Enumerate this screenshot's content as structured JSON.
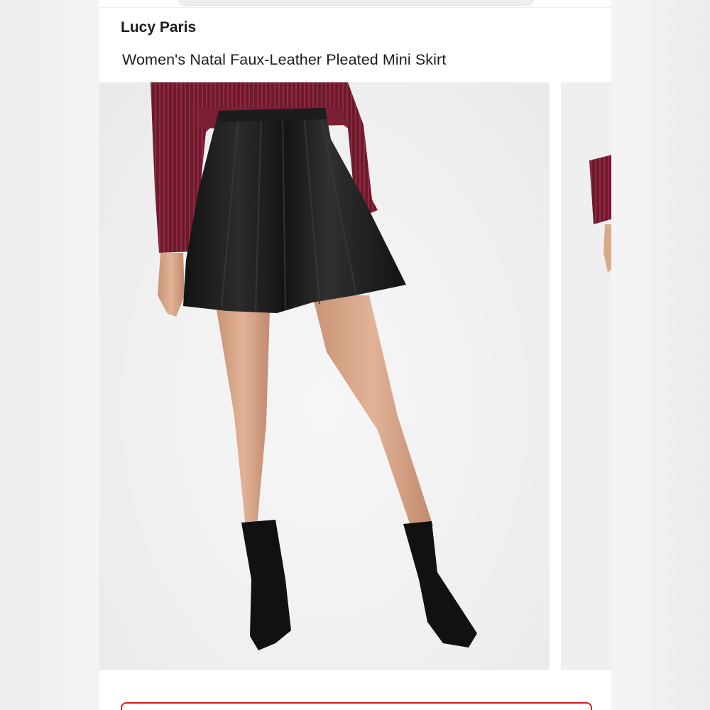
{
  "product": {
    "brand": "Lucy Paris",
    "title": "Women's Natal Faux-Leather Pleated Mini Skirt"
  },
  "gallery": {
    "main_image": "model wearing black faux-leather pleated mini skirt, burgundy pleated blouse and black ankle boots",
    "next_image": "partial view of next product photo"
  },
  "colors": {
    "accent": "#e11919",
    "skirt": "#1a1a1a",
    "blouse": "#7a1f33",
    "background": "#f0f0f0"
  }
}
